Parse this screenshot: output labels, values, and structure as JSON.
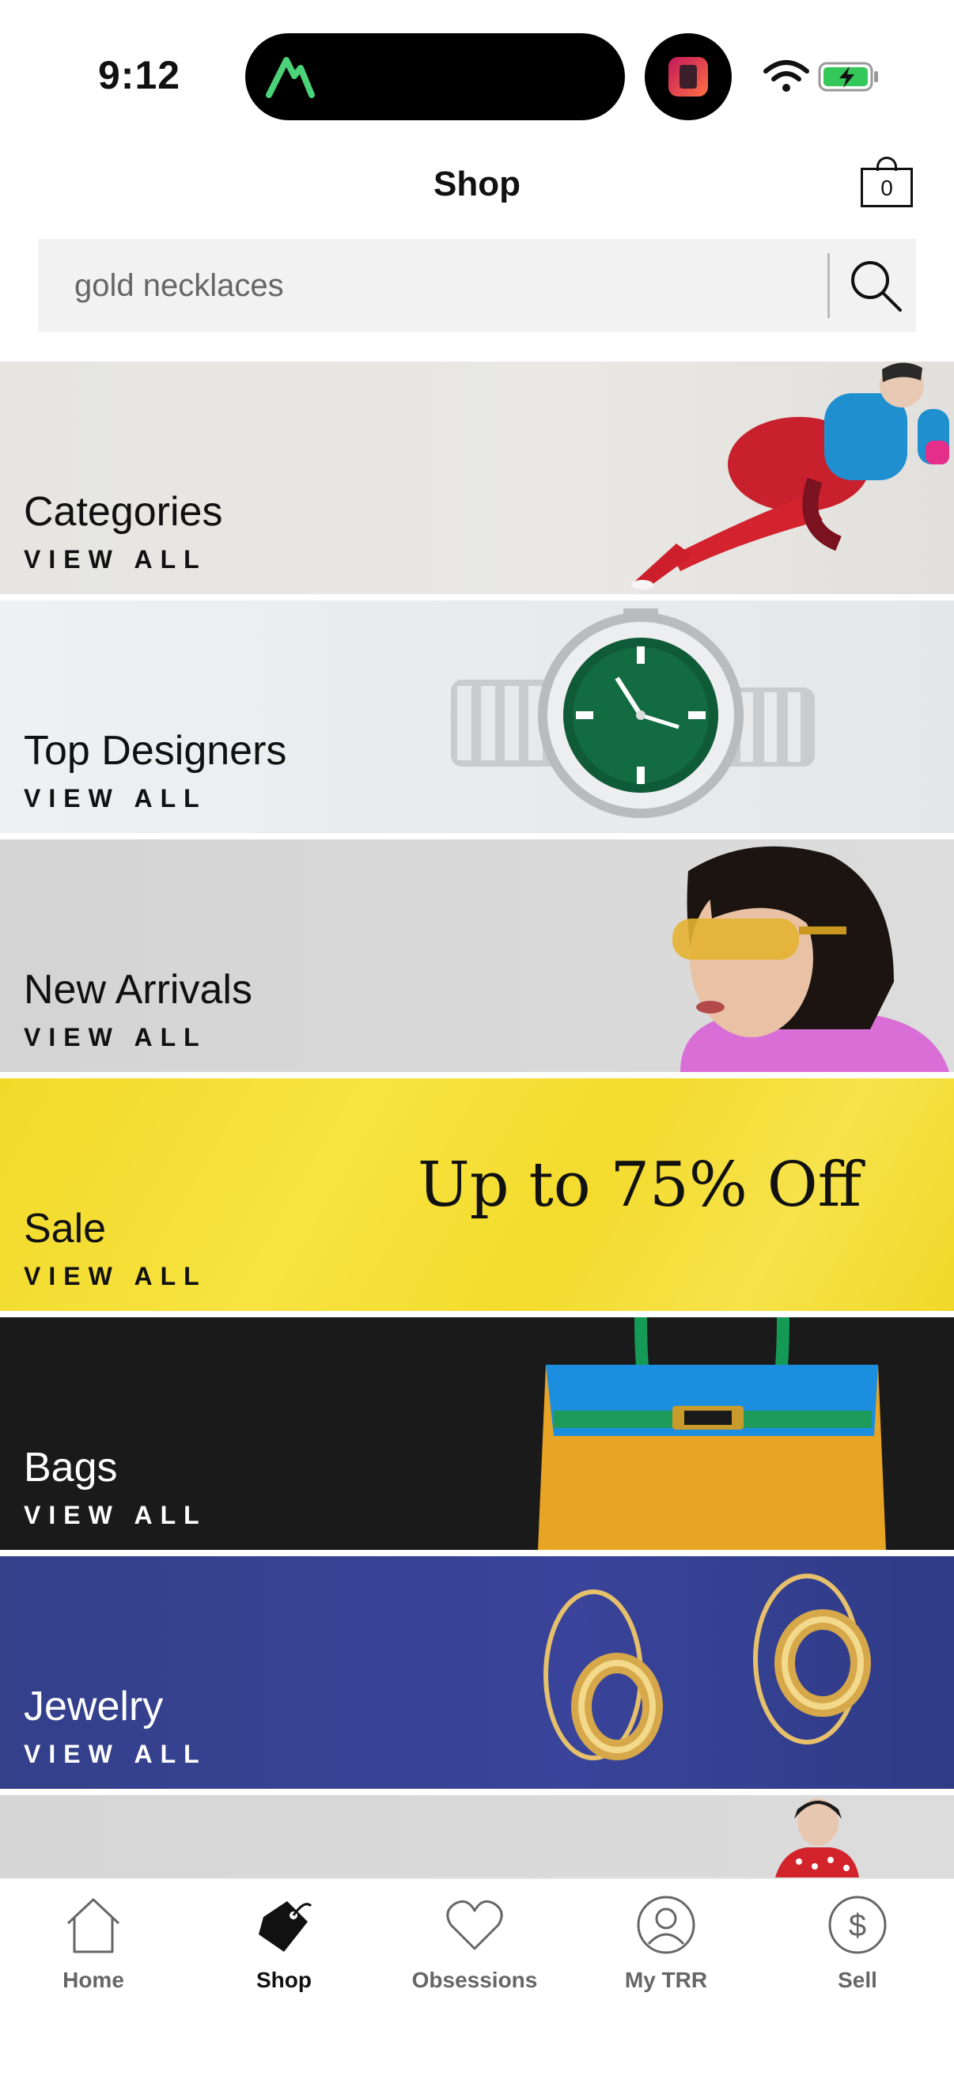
{
  "status_bar": {
    "time": "9:12"
  },
  "header": {
    "title": "Shop",
    "bag_count": "0"
  },
  "search": {
    "value": "gold necklaces",
    "placeholder": "gold necklaces"
  },
  "banners": [
    {
      "title": "Categories",
      "cta": "VIEW ALL",
      "image": "model-in-red-skirt-image"
    },
    {
      "title": "Top Designers",
      "cta": "VIEW ALL",
      "image": "green-dial-watch-image"
    },
    {
      "title": "New Arrivals",
      "cta": "VIEW ALL",
      "image": "model-with-yellow-sunglasses-image"
    },
    {
      "title": "Sale",
      "cta": "VIEW ALL",
      "headline": "Up to 75% Off"
    },
    {
      "title": "Bags",
      "cta": "VIEW ALL",
      "image": "colorblock-handbag-image"
    },
    {
      "title": "Jewelry",
      "cta": "VIEW ALL",
      "image": "gold-hoop-earrings-image"
    }
  ],
  "tabbar": {
    "items": [
      {
        "label": "Home",
        "icon": "home-icon",
        "active": false
      },
      {
        "label": "Shop",
        "icon": "price-tag-icon",
        "active": true
      },
      {
        "label": "Obsessions",
        "icon": "heart-icon",
        "active": false
      },
      {
        "label": "My TRR",
        "icon": "user-icon",
        "active": false
      },
      {
        "label": "Sell",
        "icon": "dollar-icon",
        "active": false
      }
    ]
  },
  "colors": {
    "sale_yellow": "#f4dc2e",
    "bags_black": "#1a1a1a",
    "jewelry_blue": "#36429a",
    "active_tab": "#111111",
    "inactive_tab": "#666666"
  }
}
